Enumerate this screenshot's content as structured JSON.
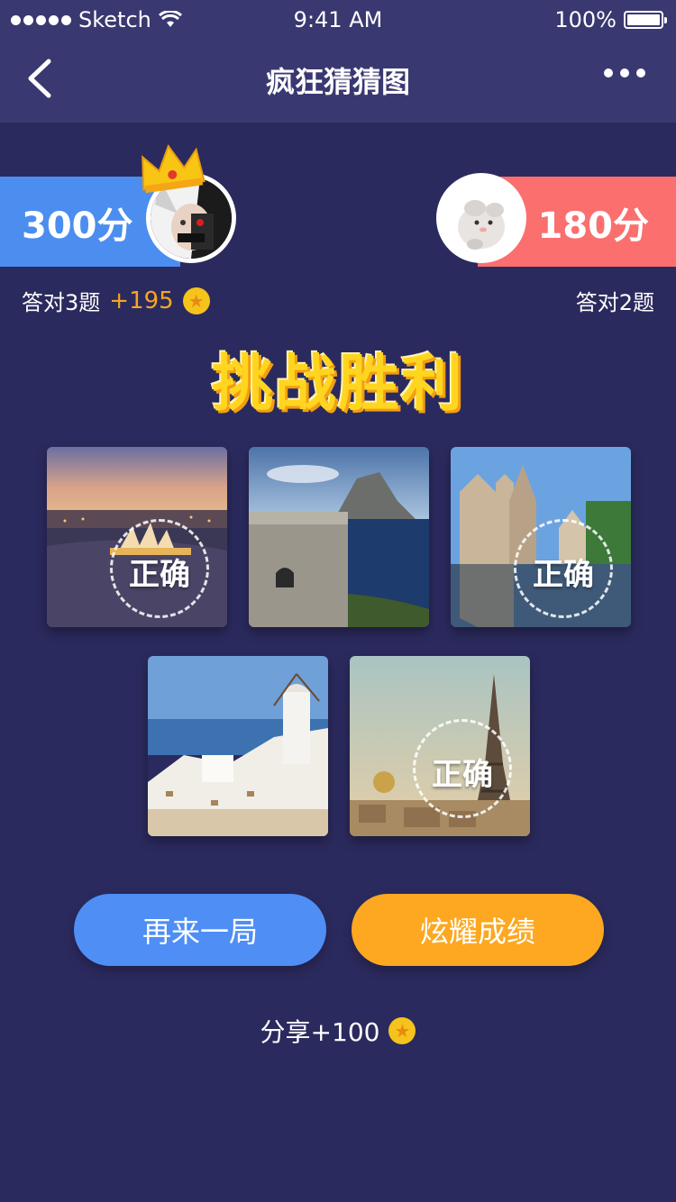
{
  "status": {
    "carrier": "Sketch",
    "time": "9:41 AM",
    "battery": "100%"
  },
  "nav": {
    "title": "疯狂猜猜图"
  },
  "players": {
    "left": {
      "score": "300分",
      "correct": "答对3题",
      "bonus": "+195"
    },
    "right": {
      "score": "180分",
      "correct": "答对2题"
    }
  },
  "result": "挑战胜利",
  "stamp_text": "正确",
  "images": [
    {
      "icon": "sydney-opera-house-image",
      "correct": true
    },
    {
      "icon": "coastal-tower-island-image",
      "correct": false
    },
    {
      "icon": "castle-lake-image",
      "correct": true
    },
    {
      "icon": "santorini-windmill-image",
      "correct": false
    },
    {
      "icon": "paris-eiffel-tower-image",
      "correct": true
    }
  ],
  "buttons": {
    "again": "再来一局",
    "show": "炫耀成绩"
  },
  "share": "分享+100",
  "colors": {
    "bg": "#2b2a5e",
    "left_score": "#4b8ef0",
    "right_score": "#fb6f6f",
    "accent": "#fda820"
  }
}
